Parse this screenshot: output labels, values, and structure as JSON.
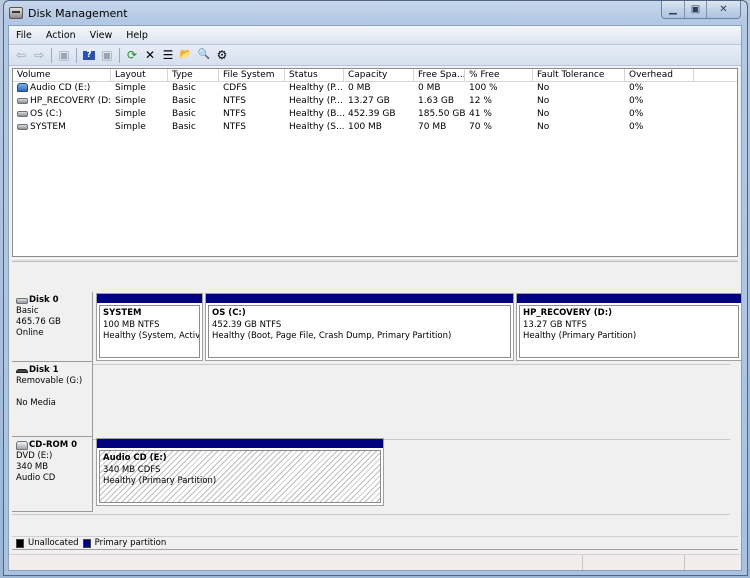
{
  "window": {
    "title": "Disk Management",
    "caption_buttons": {
      "minimize": "▁",
      "maximize": "▣",
      "close": "✕"
    }
  },
  "menu": [
    "File",
    "Action",
    "View",
    "Help"
  ],
  "toolbar": [
    {
      "name": "back-icon",
      "glyph": "⇦",
      "enabled": false
    },
    {
      "name": "forward-icon",
      "glyph": "⇨",
      "enabled": false
    },
    {
      "sep": true
    },
    {
      "name": "show-hide-console-tree-icon",
      "glyph": "▣",
      "enabled": false
    },
    {
      "sep": true
    },
    {
      "name": "help-icon",
      "glyph": "?",
      "enabled": true
    },
    {
      "name": "show-hide-action-pane-icon",
      "glyph": "▣",
      "enabled": false
    },
    {
      "sep": true
    },
    {
      "name": "refresh-icon",
      "glyph": "⟳",
      "enabled": true
    },
    {
      "name": "delete-icon",
      "glyph": "✕",
      "enabled": true
    },
    {
      "name": "properties-icon",
      "glyph": "☰",
      "enabled": true
    },
    {
      "name": "open-folder-icon",
      "glyph": "📂",
      "enabled": true
    },
    {
      "name": "explore-icon",
      "glyph": "🔍",
      "enabled": true
    },
    {
      "name": "settings-icon",
      "glyph": "⚙",
      "enabled": true
    }
  ],
  "volume_list": {
    "columns": [
      "Volume",
      "Layout",
      "Type",
      "File System",
      "Status",
      "Capacity",
      "Free Spa...",
      "% Free",
      "Fault Tolerance",
      "Overhead"
    ],
    "rows": [
      {
        "icon": "cd",
        "cells": [
          "Audio CD (E:)",
          "Simple",
          "Basic",
          "CDFS",
          "Healthy (P...",
          "0 MB",
          "0 MB",
          "100 %",
          "No",
          "0%"
        ]
      },
      {
        "icon": "disk",
        "cells": [
          "HP_RECOVERY (D:)",
          "Simple",
          "Basic",
          "NTFS",
          "Healthy (P...",
          "13.27 GB",
          "1.63 GB",
          "12 %",
          "No",
          "0%"
        ]
      },
      {
        "icon": "disk",
        "cells": [
          "OS (C:)",
          "Simple",
          "Basic",
          "NTFS",
          "Healthy (B...",
          "452.39 GB",
          "185.50 GB",
          "41 %",
          "No",
          "0%"
        ]
      },
      {
        "icon": "disk",
        "cells": [
          "SYSTEM",
          "Simple",
          "Basic",
          "NTFS",
          "Healthy (S...",
          "100 MB",
          "70 MB",
          "70 %",
          "No",
          "0%"
        ]
      }
    ]
  },
  "disks": [
    {
      "title": "Disk 0",
      "lines": [
        "Basic",
        "465.76 GB",
        "Online"
      ],
      "partitions": [
        {
          "name": "SYSTEM",
          "size": "100 MB NTFS",
          "status": "Healthy (System, Active,",
          "hatched": false
        },
        {
          "name": "OS  (C:)",
          "size": "452.39 GB NTFS",
          "status": "Healthy (Boot, Page File, Crash Dump, Primary Partition)",
          "hatched": false
        },
        {
          "name": "HP_RECOVERY  (D:)",
          "size": "13.27 GB NTFS",
          "status": "Healthy (Primary Partition)",
          "hatched": false
        }
      ]
    },
    {
      "title": "Disk 1",
      "lines": [
        "Removable (G:)",
        "",
        "No Media"
      ],
      "partitions": []
    },
    {
      "title": "CD-ROM 0",
      "lines": [
        "DVD (E:)",
        "340 MB",
        "Audio CD"
      ],
      "partitions": [
        {
          "name": "Audio CD  (E:)",
          "size": "340 MB CDFS",
          "status": "Healthy (Primary Partition)",
          "hatched": true
        }
      ]
    }
  ],
  "legend": [
    {
      "label": "Unallocated",
      "color": "#000000"
    },
    {
      "label": "Primary partition",
      "color": "#000080"
    }
  ],
  "colors": {
    "primary_partition": "#000080",
    "unallocated": "#000000"
  }
}
